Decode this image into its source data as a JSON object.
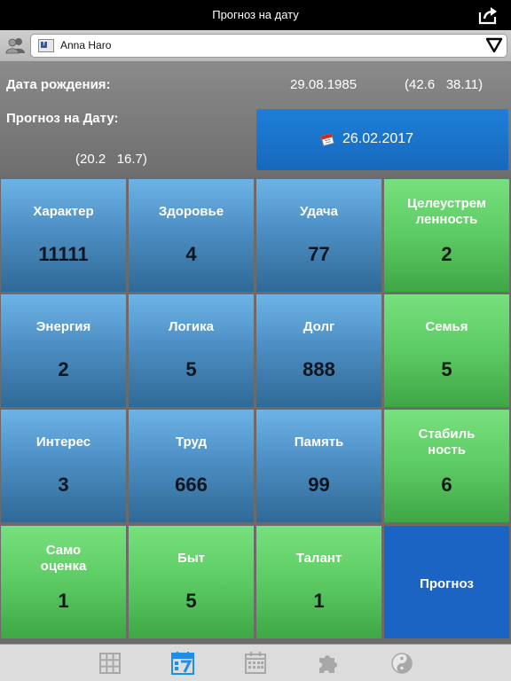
{
  "navbar": {
    "title": "Прогноз на дату"
  },
  "userbar": {
    "user_name": "Anna Haro"
  },
  "info": {
    "birth_label": "Дата рождения:",
    "birth_date": "29.08.1985",
    "birth_coords": "(42.6   38.11)",
    "forecast_label": "Прогноз на Дату:",
    "forecast_coords": "(20.2   16.7)",
    "forecast_date": "26.02.2017"
  },
  "grid": [
    {
      "title": "Характер",
      "value": "11111",
      "color": "blue"
    },
    {
      "title": "Здоровье",
      "value": "4",
      "color": "blue"
    },
    {
      "title": "Удача",
      "value": "77",
      "color": "blue"
    },
    {
      "title": "Целеустрем\nленность",
      "value": "2",
      "color": "green"
    },
    {
      "title": "Энергия",
      "value": "2",
      "color": "blue"
    },
    {
      "title": "Логика",
      "value": "5",
      "color": "blue"
    },
    {
      "title": "Долг",
      "value": "888",
      "color": "blue"
    },
    {
      "title": "Семья",
      "value": "5",
      "color": "green"
    },
    {
      "title": "Интерес",
      "value": "3",
      "color": "blue"
    },
    {
      "title": "Труд",
      "value": "666",
      "color": "blue"
    },
    {
      "title": "Память",
      "value": "99",
      "color": "blue"
    },
    {
      "title": "Стабиль\nность",
      "value": "6",
      "color": "green"
    },
    {
      "title": "Само\nоценка",
      "value": "1",
      "color": "green"
    },
    {
      "title": "Быт",
      "value": "5",
      "color": "green"
    },
    {
      "title": "Талант",
      "value": "1",
      "color": "green"
    }
  ],
  "forecast_button": "Прогноз",
  "tabs": [
    {
      "icon": "grid-icon",
      "active": false
    },
    {
      "icon": "calendar-seven-icon",
      "active": true
    },
    {
      "icon": "calendar-icon",
      "active": false
    },
    {
      "icon": "puzzle-icon",
      "active": false
    },
    {
      "icon": "yin-yang-icon",
      "active": false
    }
  ],
  "colors": {
    "accent": "#1b64c3",
    "tile_blue": "#4d8fc4",
    "tile_green": "#5ccb63",
    "tab_active": "#1f8ee8",
    "tab_inactive": "#a8a8a8"
  }
}
